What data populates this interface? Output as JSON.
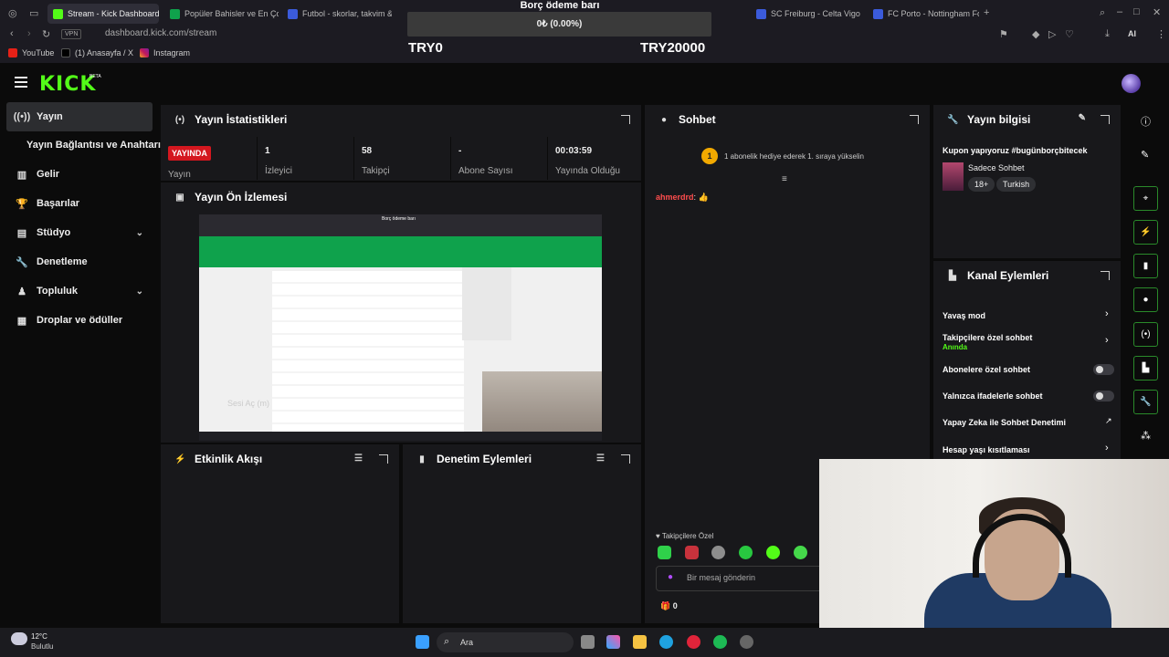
{
  "browser": {
    "tabs": [
      {
        "label": "Stream - Kick Dashboard",
        "active": true,
        "color": "#53fc18"
      },
      {
        "label": "Popüler Bahisler ve En Ço",
        "active": false,
        "color": "#0fa24c"
      },
      {
        "label": "Futbol - skorlar, takvim &",
        "active": false,
        "color": "#3b5bdb"
      },
      {
        "label": "SC Freiburg - Celta Vigo c",
        "active": false,
        "color": "#3b5bdb"
      },
      {
        "label": "FC Porto - Nottingham For",
        "active": false,
        "color": "#3b5bdb"
      }
    ],
    "url": "dashboard.kick.com/stream",
    "vpn_label": "VPN",
    "bookmarks": [
      "YouTube",
      "(1) Anasayfa / X",
      "Instagram"
    ]
  },
  "debt_bar": {
    "title": "Borç ödeme barı",
    "progress_text": "0₺ (0.00%)",
    "progress_fraction": 0,
    "min_label": "TRY0",
    "max_label": "TRY20000"
  },
  "header": {
    "logo": "KICK",
    "beta": "BETA",
    "brand_color": "#53fc18"
  },
  "sidebar": {
    "items": [
      {
        "label": "Yayın",
        "icon": "broadcast-icon"
      },
      {
        "label": "Yayın Bağlantısı ve Anahtarı",
        "icon": ""
      },
      {
        "label": "Gelir",
        "icon": "chart-icon"
      },
      {
        "label": "Başarılar",
        "icon": "trophy-icon"
      },
      {
        "label": "Stüdyo",
        "icon": "studio-icon"
      },
      {
        "label": "Denetleme",
        "icon": "wrench-icon"
      },
      {
        "label": "Topluluk",
        "icon": "community-icon"
      },
      {
        "label": "Droplar ve ödüller",
        "icon": "drops-icon"
      }
    ]
  },
  "stats_panel": {
    "title": "Yayın İstatistikleri",
    "live_badge": "YAYINDA",
    "live_label": "Yayın",
    "stats": [
      {
        "value": "1",
        "label": "İzleyici"
      },
      {
        "value": "58",
        "label": "Takipçi"
      },
      {
        "value": "-",
        "label": "Abone Sayısı"
      },
      {
        "value": "00:03:59",
        "label": "Yayında Olduğu"
      }
    ]
  },
  "preview_panel": {
    "title": "Yayın Ön İzlemesi",
    "mute_text": "Sesi Aç (m)"
  },
  "activity_panel": {
    "title": "Etkinlik Akışı"
  },
  "moderation_panel": {
    "title": "Denetim Eylemleri"
  },
  "chat_panel": {
    "title": "Sohbet",
    "notice_badge": "1",
    "notice": "1 abonelik hediye ederek 1. sıraya yükselin",
    "message_user": "ahmerdrd",
    "message_text": ": 👍",
    "follower_label": "♥ Takipçilere Özel",
    "input_placeholder": "Bir mesaj gönderin",
    "gift_count": "0"
  },
  "info_panel": {
    "title": "Yayın bilgisi",
    "stream_title": "Kupon yapıyoruz #bugünborçbitecek",
    "category": "Sadece Sohbet",
    "tags": [
      "18+",
      "Turkish"
    ]
  },
  "channel_actions": {
    "title": "Kanal Eylemleri",
    "rows": [
      {
        "label": "Yavaş mod",
        "control": "chevron"
      },
      {
        "label": "Takipçilere özel sohbet",
        "sub": "Anında",
        "control": "chevron"
      },
      {
        "label": "Abonelere özel sohbet",
        "control": "toggle"
      },
      {
        "label": "Yalnızca ifadelerle sohbet",
        "control": "toggle"
      },
      {
        "label": "Yapay Zeka ile Sohbet Denetimi",
        "control": "external"
      },
      {
        "label": "Hesap yaşı kısıtlaması",
        "control": "chevron"
      }
    ],
    "sub_color": "#53fc18"
  },
  "taskbar": {
    "weather_temp": "12°C",
    "weather_desc": "Bulutlu",
    "search_label": "Ara"
  }
}
